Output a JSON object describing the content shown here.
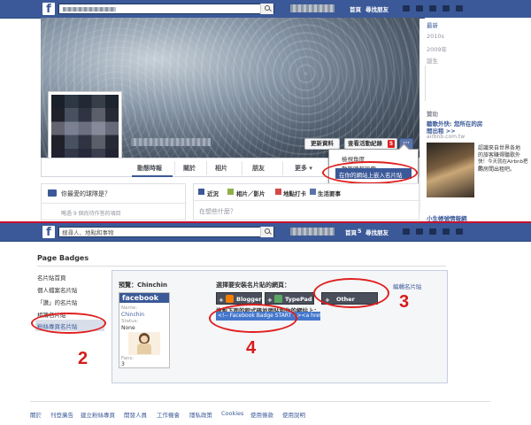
{
  "top": {
    "nav_home": "首頁",
    "nav_find_friends": "尋找朋友",
    "sidebar_right": {
      "years": [
        "最新",
        "2010s",
        "2009年",
        "誕生"
      ],
      "sponsored_label": "贊助",
      "ad1_title": "聽歌外快: 您所在的房",
      "ad1_title2": "間出租 >>",
      "ad1_domain": "airbnb.com.tw",
      "ad1_text": [
        "認識來自世界各地",
        "的旅客賺得聽歌外",
        "快！今天就在Airbnb把您",
        "的房間出租吧。"
      ],
      "ad2_title": "小生帳號情報網"
    },
    "buttons": {
      "update_info": "更新資料",
      "activity_log": "查看活動紀錄",
      "activity_count": "5",
      "more": "···"
    },
    "tabs": [
      "動態時報",
      "關於",
      "相片",
      "朋友",
      "更多 ▾"
    ],
    "dropdown": {
      "items": [
        "檢視角度",
        "動態時報設定",
        "在你的網站上嵌入名片貼"
      ]
    },
    "friends_card": {
      "title": "你最愛的球隊是？",
      "sub": "略過 9 個尚待作答的項目"
    },
    "composer": {
      "tabs": [
        "近況",
        "相片／影片",
        "地點打卡",
        "生活要事"
      ],
      "placeholder": "在想些什麼？"
    },
    "annotation_1": "1"
  },
  "bottom": {
    "search_placeholder": "搜尋人、地點和事物",
    "nav_home": "首頁",
    "nav_home_count": "5",
    "nav_find_friends": "尋找朋友",
    "page_title": "Page Badges",
    "left_nav": [
      "名片貼首頁",
      "個人檔案名片貼",
      "「讚」的名片貼",
      "相簿名片貼",
      "粉絲專頁名片貼"
    ],
    "preview_label": "預覽：Chinchin",
    "badge": {
      "brand": "facebook",
      "name_label": "Name:",
      "name": "Chinchin",
      "status_label": "Status:",
      "status": "None",
      "fans_label": "Fans:",
      "fans": "3"
    },
    "choose_site": "選擇要安裝名片貼的網頁：",
    "edit_badge": "編輯名片貼",
    "site_buttons": [
      "Blogger",
      "TypePad",
      "Other"
    ],
    "copy_instruction": "複製下面的程式碼並張貼到你的網站上：",
    "code_snippet": "<!-- Facebook Badge START --><a href=\"ht",
    "annotations": [
      "2",
      "3",
      "4"
    ],
    "footer_links": [
      "關於",
      "刊登廣告",
      "建立粉絲專頁",
      "開發人員",
      "工作機會",
      "隱私政策",
      "Cookies",
      "使用條款",
      "使用說明"
    ]
  },
  "colors": {
    "fb_blue": "#3b5998",
    "annotation_red": "#e02020"
  }
}
